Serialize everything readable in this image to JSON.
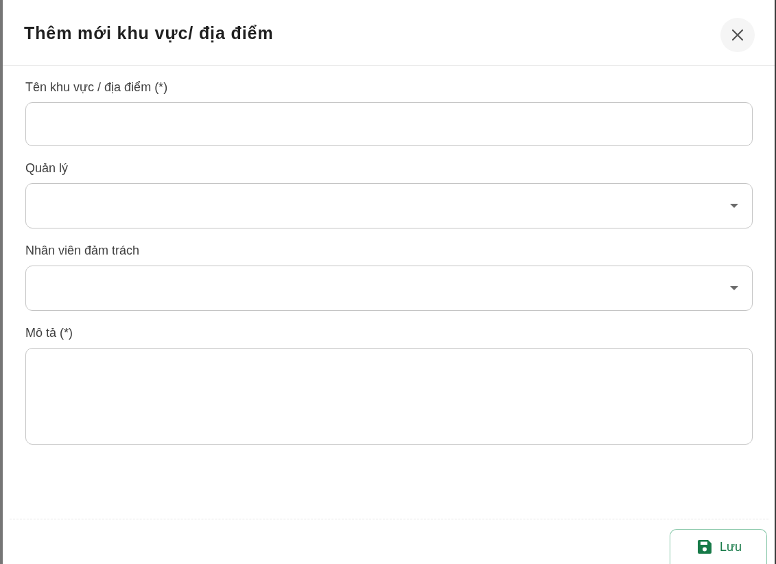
{
  "dialog": {
    "title": "Thêm mới khu vực/ địa điểm",
    "fields": [
      {
        "kind": "text",
        "label": "Tên khu vực / địa điểm (*)"
      },
      {
        "kind": "select",
        "label": "Quản lý"
      },
      {
        "kind": "select",
        "label": "Nhân viên đảm trách"
      },
      {
        "kind": "textarea",
        "label": "Mô tả (*)"
      }
    ],
    "buttons": [
      {
        "kind": "save",
        "label": "Lưu"
      }
    ]
  }
}
